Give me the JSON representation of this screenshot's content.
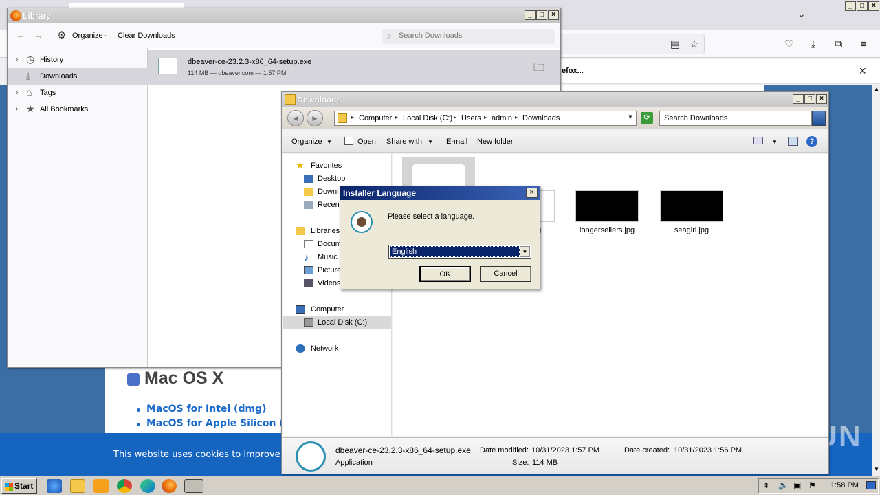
{
  "library": {
    "title": "Library",
    "organize": "Organize",
    "clear_downloads": "Clear Downloads",
    "search_placeholder": "Search Downloads",
    "sidebar": [
      {
        "label": "History",
        "icon": "clock-icon",
        "selected": false
      },
      {
        "label": "Downloads",
        "icon": "download-icon",
        "selected": true
      },
      {
        "label": "Tags",
        "icon": "tag-icon",
        "selected": false
      },
      {
        "label": "All Bookmarks",
        "icon": "star-icon",
        "selected": false
      }
    ],
    "download": {
      "name": "dbeaver-ce-23.2.3-x86_64-setup.exe",
      "meta": "114 MB — dbeaver.com — 1:57 PM"
    }
  },
  "firefox": {
    "notification": "efox...",
    "mac_heading": "Mac OS X",
    "mac_links": [
      "MacOS for Intel (dmg)",
      "MacOS for Apple Silicon (dm"
    ],
    "cookie_text": "This website uses cookies to improve you"
  },
  "explorer": {
    "title": "Downloads",
    "breadcrumb": [
      "Computer",
      "Local Disk (C:)",
      "Users",
      "admin",
      "Downloads"
    ],
    "search_placeholder": "Search Downloads",
    "commands": [
      "Organize",
      "Open",
      "Share with",
      "E-mail",
      "New folder"
    ],
    "nav": {
      "favorites": "Favorites",
      "desktop": "Desktop",
      "downloads": "Downl",
      "recent": "Recen",
      "libraries": "Libraries",
      "documents": "Docum",
      "music": "Music",
      "pictures": "Picture",
      "videos": "Videos",
      "computer": "Computer",
      "local_disk": "Local Disk (C:)",
      "network": "Network"
    },
    "files": [
      {
        "label": "ng"
      },
      {
        "label": "longersellers.jpg"
      },
      {
        "label": "seagirl.jpg"
      }
    ],
    "details": {
      "name": "dbeaver-ce-23.2.3-x86_64-setup.exe",
      "type": "Application",
      "modified_label": "Date modified:",
      "modified": "10/31/2023 1:57 PM",
      "created_label": "Date created:",
      "created": "10/31/2023 1:56 PM",
      "size_label": "Size:",
      "size": "114 MB"
    }
  },
  "dialog": {
    "title": "Installer Language",
    "message": "Please select a language.",
    "selected_language": "English",
    "ok": "OK",
    "cancel": "Cancel"
  },
  "taskbar": {
    "start": "Start",
    "clock": "1:58 PM"
  },
  "watermark": "ANY RUN"
}
